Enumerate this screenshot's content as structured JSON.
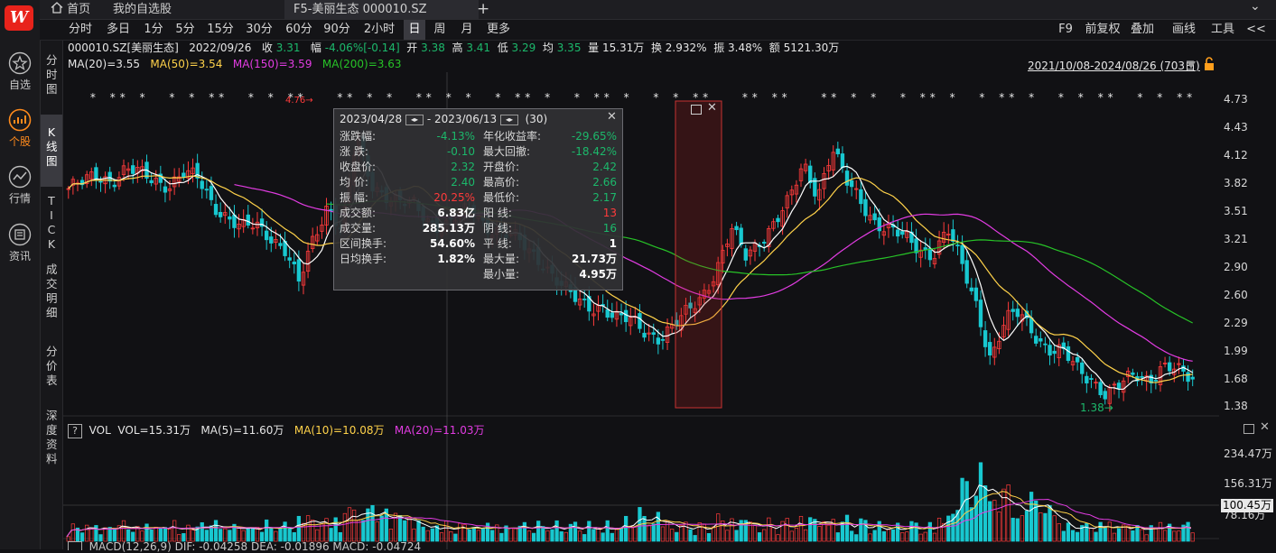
{
  "app": {
    "logo": "W"
  },
  "tabs": {
    "home": "首页",
    "watchlist": "我的自选股",
    "active": "F5-美丽生态 000010.SZ",
    "add": "+",
    "chevron": "⌄"
  },
  "sidebar": {
    "items": [
      {
        "label": "自选",
        "icon": "star-icon"
      },
      {
        "label": "个股",
        "icon": "stock-chart-icon"
      },
      {
        "label": "行情",
        "icon": "market-trend-icon"
      },
      {
        "label": "资讯",
        "icon": "news-icon"
      }
    ]
  },
  "periods": {
    "items": [
      "分时",
      "多日",
      "1分",
      "5分",
      "15分",
      "30分",
      "60分",
      "90分",
      "2小时",
      "日",
      "周",
      "月",
      "更多"
    ],
    "active": "日",
    "right": [
      "F9",
      "前复权",
      "叠加",
      "画线",
      "工具",
      "<<"
    ]
  },
  "subtabs": {
    "items": [
      "分时图",
      "K线图",
      "TICK",
      "成交明细",
      "分价表",
      "深度资料"
    ],
    "active": "K线图"
  },
  "quote": {
    "code": "000010.SZ[美丽生态]",
    "date": "2022/09/26",
    "close_label": "收",
    "close": "3.31",
    "chg_label": "幅",
    "chg": "-4.06%[-0.14]",
    "open_label": "开",
    "open": "3.38",
    "high_label": "高",
    "high": "3.41",
    "low_label": "低",
    "low": "3.29",
    "avg_label": "均",
    "avg": "3.35",
    "vol_label": "量",
    "vol": "15.31万",
    "turn_label": "换",
    "turn": "2.932%",
    "amp_label": "振",
    "amp": "3.48%",
    "amt_label": "额",
    "amt": "5121.30万"
  },
  "ma": {
    "ma20": "MA(20)=3.55",
    "ma50": "MA(50)=3.54",
    "ma150": "MA(150)=3.59",
    "ma200": "MA(200)=3.63"
  },
  "range_label": "2021/10/08-2024/08/26 (703日)",
  "popup": {
    "start": "2023/04/28",
    "sep": "- 2023/06/13",
    "days": "(30)",
    "left_rows": [
      {
        "label": "涨跌幅:",
        "value": "-4.13%",
        "color": "green"
      },
      {
        "label": "涨  跌:",
        "value": "-0.10",
        "color": "green"
      },
      {
        "label": "收盘价:",
        "value": "2.32",
        "color": "green"
      },
      {
        "label": "均  价:",
        "value": "2.40",
        "color": "green"
      },
      {
        "label": "振  幅:",
        "value": "20.25%",
        "color": "red"
      },
      {
        "label": "成交额:",
        "value": "6.83亿",
        "color": "white"
      },
      {
        "label": "成交量:",
        "value": "285.13万",
        "color": "white"
      },
      {
        "label": "区间换手:",
        "value": "54.60%",
        "color": "white"
      },
      {
        "label": "日均换手:",
        "value": "1.82%",
        "color": "white"
      }
    ],
    "right_rows": [
      {
        "label": "年化收益率:",
        "value": "-29.65%",
        "color": "green"
      },
      {
        "label": "最大回撤:",
        "value": "-18.42%",
        "color": "green"
      },
      {
        "label": "开盘价:",
        "value": "2.42",
        "color": "green"
      },
      {
        "label": "最高价:",
        "value": "2.66",
        "color": "green"
      },
      {
        "label": "最低价:",
        "value": "2.17",
        "color": "green"
      },
      {
        "label": "阳  线:",
        "value": "13",
        "color": "red"
      },
      {
        "label": "阴  线:",
        "value": "16",
        "color": "green"
      },
      {
        "label": "平  线:",
        "value": "1",
        "color": "white"
      },
      {
        "label": "最大量:",
        "value": "21.73万",
        "color": "white"
      },
      {
        "label": "最小量:",
        "value": "4.95万",
        "color": "white"
      }
    ]
  },
  "price_axis": [
    "4.73",
    "4.43",
    "4.12",
    "3.82",
    "3.51",
    "3.21",
    "2.90",
    "2.60",
    "2.29",
    "1.99",
    "1.68",
    "1.38"
  ],
  "price_annotations": {
    "high": "4.76",
    "low": "1.38"
  },
  "vol": {
    "label": "VOL",
    "vol": "VOL=15.31万",
    "ma5": "MA(5)=11.60万",
    "ma10": "MA(10)=10.08万",
    "ma20": "MA(20)=11.03万",
    "axis": [
      "234.47万",
      "156.31万",
      "78.16万"
    ],
    "cursor_value": "100.45万"
  },
  "macd": {
    "label": "MACD(12,26,9)  DIF: -0.04258  DEA: -0.01896  MACD: -0.04724"
  },
  "colors": {
    "up": "#ff3b3b",
    "down": "#18c8d0",
    "ma20": "#ffffff",
    "ma50": "#ffd24a",
    "ma150": "#e23ce2",
    "ma200": "#27c327",
    "bg": "#111114"
  },
  "chart_data": {
    "type": "candlestick",
    "title": "000010.SZ[美丽生态]",
    "period": "日",
    "date_range": [
      "2021/10/08",
      "2024/08/26"
    ],
    "ylim": [
      1.38,
      4.73
    ],
    "y_ticks": [
      4.73,
      4.43,
      4.12,
      3.82,
      3.51,
      3.21,
      2.9,
      2.6,
      2.29,
      1.99,
      1.68,
      1.38
    ],
    "close_path_approx": [
      3.75,
      3.8,
      3.9,
      3.85,
      3.95,
      3.9,
      3.85,
      3.8,
      3.9,
      3.85,
      3.6,
      3.45,
      3.3,
      3.35,
      3.25,
      3.1,
      2.7,
      3.2,
      3.6,
      3.3,
      4.3,
      3.8,
      3.7,
      3.6,
      3.55,
      3.4,
      3.35,
      3.45,
      3.5,
      3.35,
      3.3,
      3.2,
      3.05,
      2.95,
      2.75,
      2.55,
      2.45,
      2.5,
      2.35,
      2.3,
      2.2,
      2.15,
      2.25,
      2.4,
      2.6,
      2.9,
      3.3,
      3.0,
      3.2,
      3.4,
      3.6,
      4.0,
      3.7,
      4.2,
      3.8,
      3.6,
      3.4,
      3.3,
      3.2,
      3.1,
      3.05,
      3.3,
      2.9,
      2.5,
      1.9,
      2.3,
      2.4,
      2.2,
      2.0,
      1.95,
      1.8,
      1.7,
      1.5,
      1.6,
      1.75,
      1.7,
      1.8,
      1.75,
      1.7
    ],
    "ma_series": [
      {
        "name": "MA(20)",
        "last": 3.55,
        "color": "#ffffff"
      },
      {
        "name": "MA(50)",
        "last": 3.54,
        "color": "#ffd24a"
      },
      {
        "name": "MA(150)",
        "last": 3.59,
        "color": "#e23ce2"
      },
      {
        "name": "MA(200)",
        "last": 3.63,
        "color": "#27c327"
      }
    ],
    "volume_ylim": [
      0,
      234.47
    ],
    "volume_ticks": [
      234.47,
      156.31,
      78.16
    ]
  }
}
